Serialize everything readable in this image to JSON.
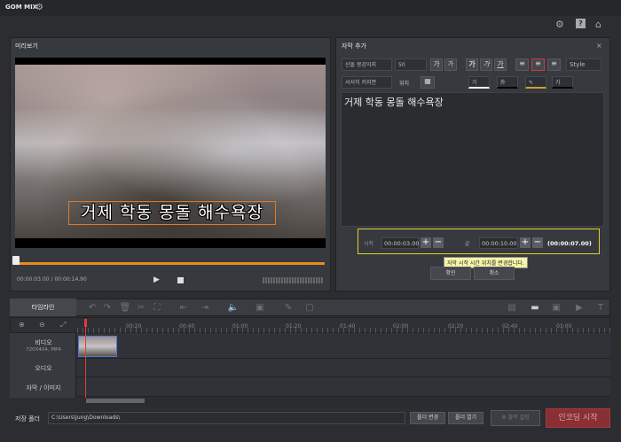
{
  "app": {
    "title": "GOM MIX"
  },
  "preview": {
    "title": "미리보기",
    "subtitle_text": "거제 학동 몽돌 해수욕장",
    "time_display": "00:00:03.00 / 00:00:14.90"
  },
  "subtitle_panel": {
    "title": "자막 추가",
    "font": "산돌 몽강이지",
    "size": "50",
    "style_label": "Style",
    "effect": "서서히 커지면",
    "position_label": "위치",
    "text": "거제 학동 몽돌 해수욕장",
    "start_label": "시작",
    "start_time": "00:00:03.00",
    "end_label": "끝",
    "end_time": "00:00:10.00",
    "duration": "(00:00:07.00)",
    "tooltip": "자막 시작 시간 위치를 변경합니다.",
    "confirm": "확인",
    "cancel": "취소"
  },
  "timeline": {
    "tab_label": "타임라인",
    "ticks": [
      "00:20",
      "00:40",
      "01:00",
      "01:20",
      "01:40",
      "02:00",
      "02:20",
      "02:40",
      "03:00"
    ],
    "tracks": [
      {
        "name": "비디오",
        "info": "720X404, MP4"
      },
      {
        "name": "오디오",
        "info": ""
      },
      {
        "name": "자막 / 이미지",
        "info": ""
      }
    ]
  },
  "footer": {
    "save_label": "저장 폴더",
    "save_path": "C:\\Users\\Jung\\Downloads\\",
    "change_folder": "폴더 변경",
    "open_folder": "폴더 열기",
    "output_settings": "출력 설정",
    "encode": "인코딩 시작"
  }
}
